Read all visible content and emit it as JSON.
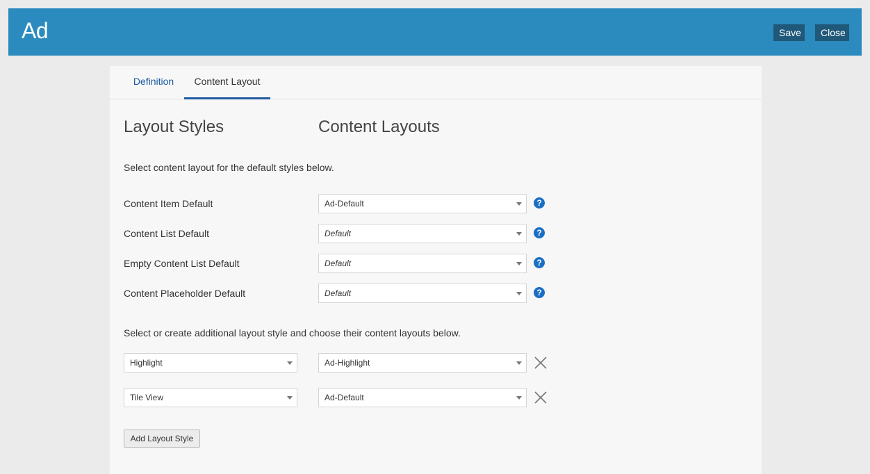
{
  "header": {
    "title": "Ad",
    "save_label": "Save",
    "close_label": "Close"
  },
  "tabs": [
    {
      "label": "Definition",
      "active": false
    },
    {
      "label": "Content Layout",
      "active": true
    }
  ],
  "headings": {
    "layout_styles": "Layout Styles",
    "content_layouts": "Content Layouts"
  },
  "default_note": "Select content layout for the default styles below.",
  "default_rows": [
    {
      "label": "Content Item Default",
      "value": "Ad-Default",
      "italic": false,
      "help_icon": "question-circle-icon"
    },
    {
      "label": "Content List Default",
      "value": "Default",
      "italic": true,
      "help_icon": "question-circle-icon"
    },
    {
      "label": "Empty Content List Default",
      "value": "Default",
      "italic": true,
      "help_icon": "question-circle-icon"
    },
    {
      "label": "Content Placeholder Default",
      "value": "Default",
      "italic": true,
      "help_icon": "question-circle-icon"
    }
  ],
  "additional_note": "Select or create additional layout style and choose their content layouts below.",
  "additional_rows": [
    {
      "style": "Highlight",
      "layout": "Ad-Highlight",
      "remove_icon": "close-icon"
    },
    {
      "style": "Tile View",
      "layout": "Ad-Default",
      "remove_icon": "close-icon"
    }
  ],
  "add_button_label": "Add Layout Style",
  "colors": {
    "header_bg": "#2b8bbf",
    "header_button_bg": "#1f5878",
    "active_tab_underline": "#1f5aa0",
    "help_icon": "#1a6fc4"
  },
  "help_glyph": "?"
}
